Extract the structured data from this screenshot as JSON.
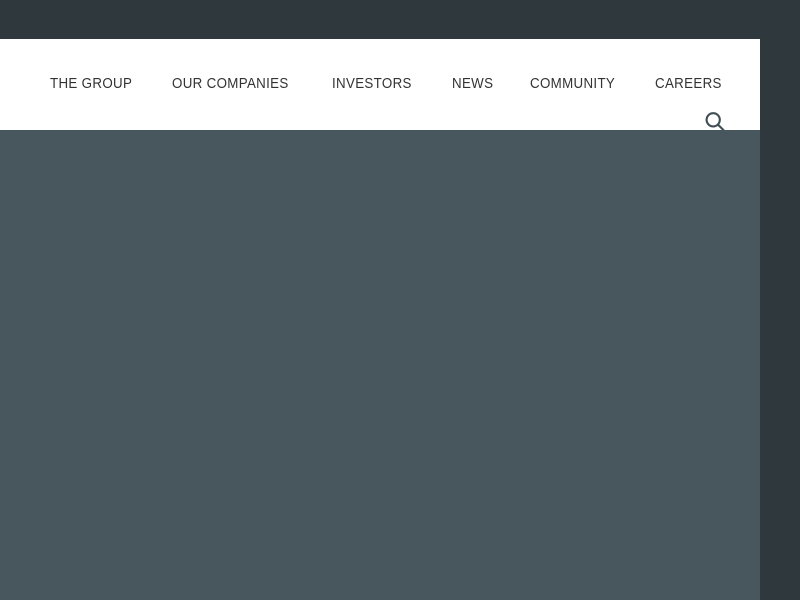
{
  "theme": {
    "topbar_color": "#2e383d",
    "header_background": "#ffffff",
    "body_color": "#48575e",
    "nav_text_color": "#333333",
    "search_icon_color": "#3f4d55",
    "right_rail_color": "#2e383d"
  },
  "topbar": {
    "label": ""
  },
  "header": {
    "nav": {
      "items": [
        {
          "label": "THE GROUP"
        },
        {
          "label": "OUR COMPANIES"
        },
        {
          "label": "INVESTORS"
        },
        {
          "label": "NEWS"
        },
        {
          "label": "COMMUNITY"
        },
        {
          "label": "CAREERS"
        }
      ]
    },
    "search": {
      "icon": "search-icon",
      "label": "Search"
    }
  },
  "hero": {
    "content": ""
  }
}
